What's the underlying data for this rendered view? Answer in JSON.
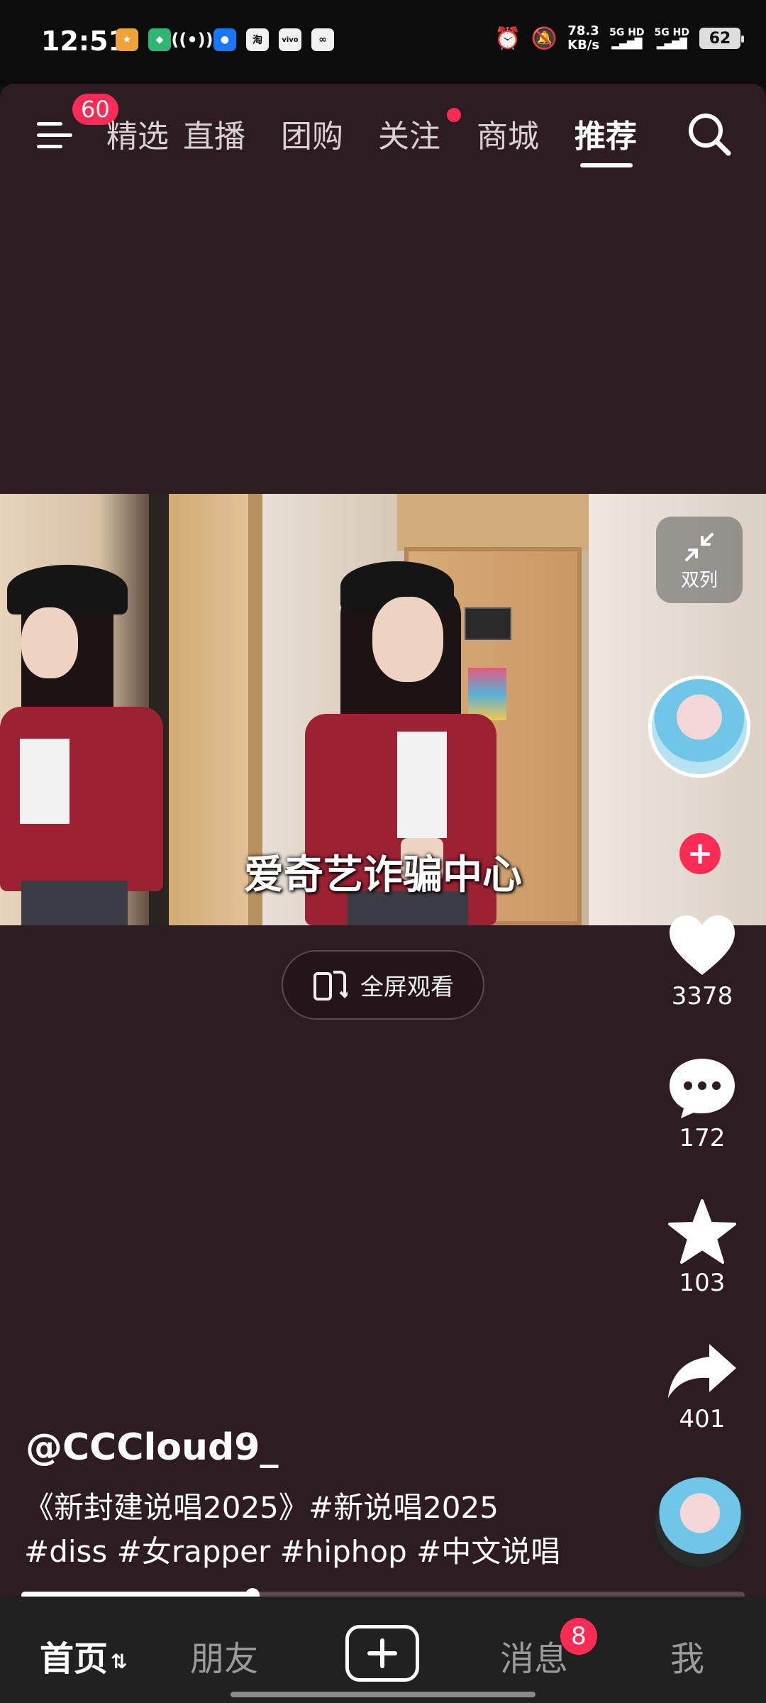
{
  "status_bar": {
    "time": "12:51",
    "notification_icons": [
      "app-icon",
      "app-icon",
      "hotspot-icon",
      "app-icon",
      "taobao-icon",
      "vivo-icon",
      "app-icon"
    ],
    "net_speed_value": "78.3",
    "net_speed_unit": "KB/s",
    "sim1": "5G HD",
    "sim2": "5G HD",
    "battery": "62"
  },
  "top_nav": {
    "menu_badge": "60",
    "tabs": [
      {
        "label": "精选"
      },
      {
        "label": "直播"
      },
      {
        "label": "团购"
      },
      {
        "label": "关注"
      },
      {
        "label": "商城"
      },
      {
        "label": "推荐"
      }
    ],
    "active_tab": "推荐"
  },
  "video": {
    "caption": "爱奇艺诈骗中心",
    "fullscreen_label": "全屏观看"
  },
  "right_rail": {
    "dual_label": "双列",
    "likes": "3378",
    "comments": "172",
    "favorites": "103",
    "shares": "401"
  },
  "post": {
    "username": "@CCCloud9_",
    "description_line1": "《新封建说唱2025》#新说唱2025",
    "description_line2": "#diss #女rapper #hiphop #中文说唱",
    "progress": 0.32
  },
  "bottom_nav": {
    "home": "首页",
    "friends": "朋友",
    "messages": "消息",
    "messages_badge": "8",
    "me": "我"
  },
  "colors": {
    "background": "#2d1c22",
    "accent": "#fe2c55",
    "nav_background": "#212121"
  }
}
